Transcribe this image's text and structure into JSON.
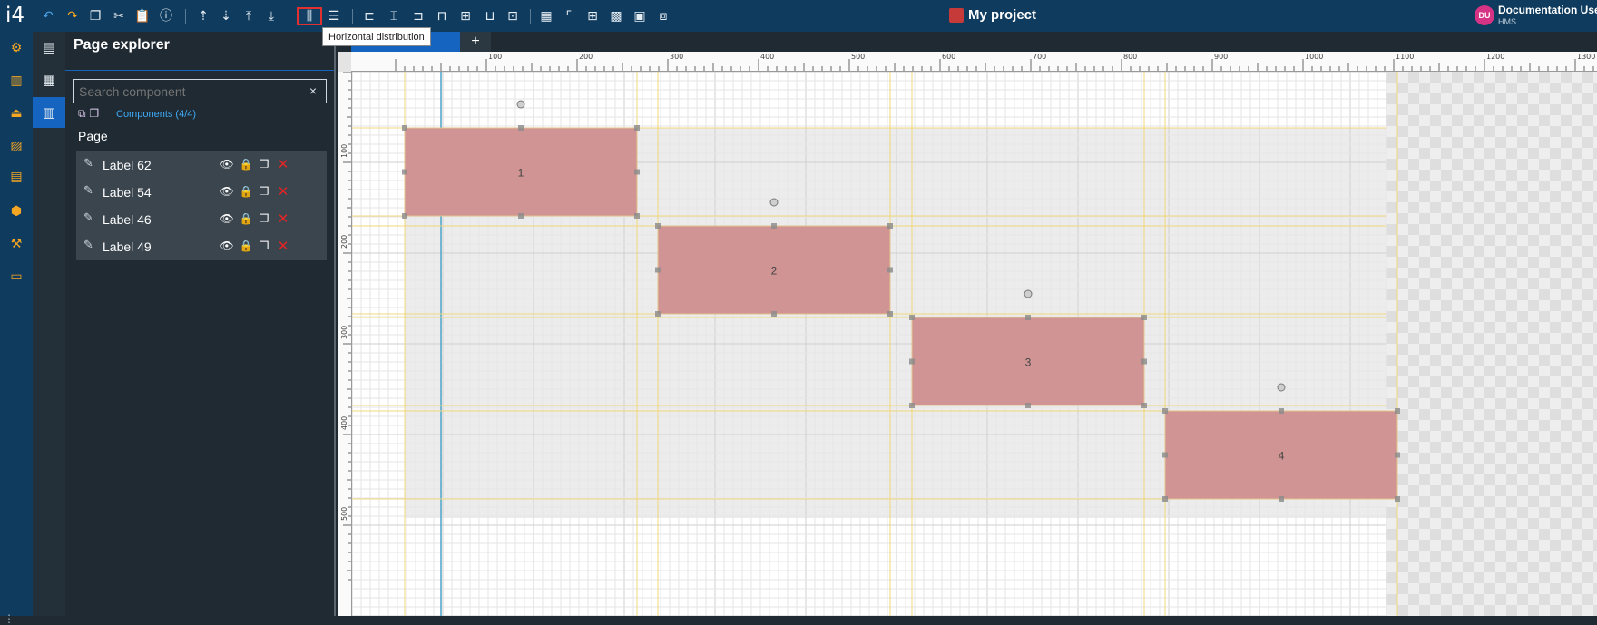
{
  "app": {
    "logo": "i4",
    "project_title": "My project",
    "user": {
      "initials": "DU",
      "name": "Documentation User",
      "org": "HMS"
    }
  },
  "toolbar": {
    "tooltip": "Horizontal distribution",
    "tab_add": "+"
  },
  "panel": {
    "title": "Page explorer",
    "search_placeholder": "Search component",
    "search_clear": "×",
    "components_count": "Components (4/4)",
    "page_label": "Page",
    "items": [
      {
        "label": "Label 62"
      },
      {
        "label": "Label 54"
      },
      {
        "label": "Label 46"
      },
      {
        "label": "Label 49"
      }
    ]
  },
  "canvas": {
    "ruler_x": [
      "100",
      "200",
      "300",
      "400",
      "500",
      "600",
      "700",
      "800",
      "900",
      "1000",
      "1100",
      "1200",
      "1300"
    ],
    "ruler_y": [
      "100",
      "200",
      "300",
      "400",
      "500"
    ],
    "labels": [
      {
        "text": "1",
        "fill": "#d09494"
      },
      {
        "text": "2",
        "fill": "#d09494"
      },
      {
        "text": "3",
        "fill": "#d09494"
      },
      {
        "text": "4",
        "fill": "#d09494"
      }
    ]
  },
  "colors": {
    "accent": "#1565c0",
    "topbar": "#0f3b5e",
    "delete": "#e32525",
    "rail_icons": "#f5a623"
  }
}
